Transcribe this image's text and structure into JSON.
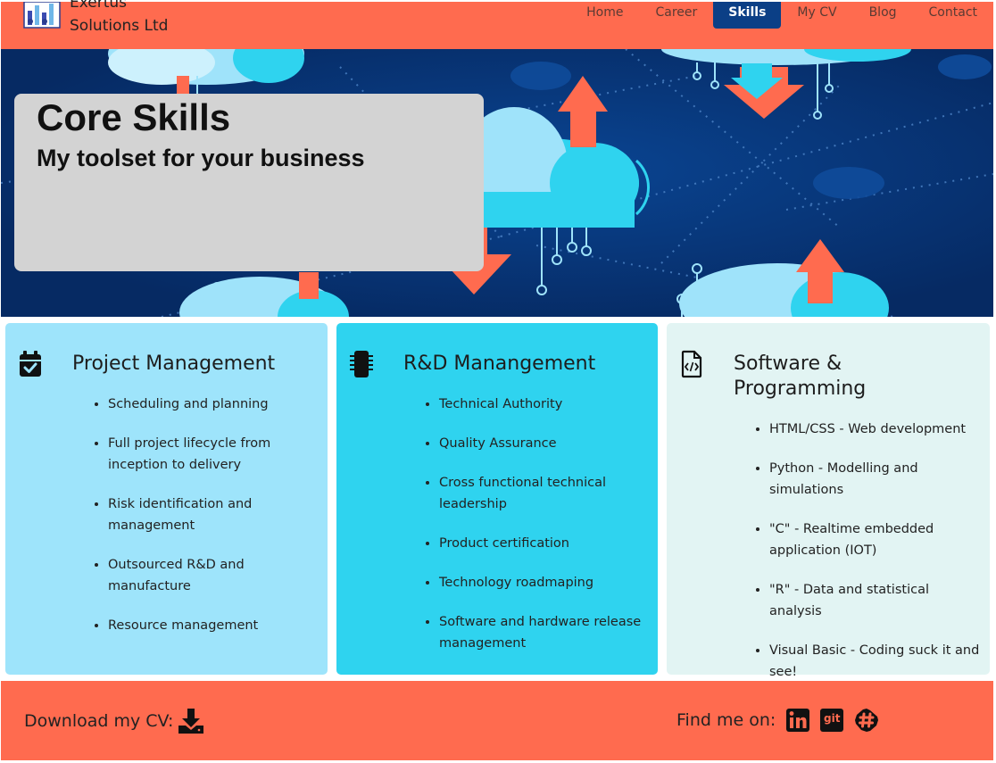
{
  "brand": {
    "line1": "Exertus",
    "line2": "Solutions Ltd"
  },
  "nav": {
    "items": [
      "Home",
      "Career",
      "Skills",
      "My CV",
      "Blog",
      "Contact"
    ],
    "active": "Skills"
  },
  "hero": {
    "title": "Core Skills",
    "subtitle": "My toolset for your business"
  },
  "cards": [
    {
      "title": "Project Management",
      "icon": "calendar-check-icon",
      "items": [
        "Scheduling and planning",
        "Full project lifecycle from inception to delivery",
        "Risk identification and management",
        "Outsourced R&D and manufacture",
        "Resource management"
      ]
    },
    {
      "title": "R&D Manangement",
      "icon": "chip-icon",
      "items": [
        "Technical Authority",
        "Quality Assurance",
        "Cross functional technical leadership",
        "Product certification",
        "Technology roadmaping",
        "Software and hardware release management"
      ]
    },
    {
      "title": "Software & Programming",
      "icon": "code-file-icon",
      "items": [
        "HTML/CSS - Web development",
        "Python - Modelling and simulations",
        "\"C\" - Realtime embedded application (IOT)",
        "\"R\" - Data and statistical analysis",
        "Visual Basic - Coding suck it and see!"
      ]
    }
  ],
  "footer": {
    "download_label": "Download my CV:",
    "find_label": "Find me on:",
    "git_label": "git"
  },
  "colors": {
    "accent": "#ff6b4f",
    "nav_active": "#0b3f86",
    "hero_bg": "#07316f",
    "card1": "#9ee4fb",
    "card2": "#2fd3ef",
    "card3": "#e2f4f3"
  }
}
